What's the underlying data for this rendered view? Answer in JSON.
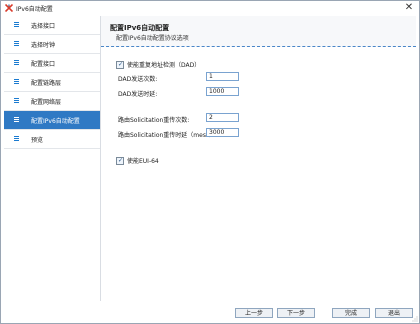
{
  "window": {
    "title": "IPv6自动配置",
    "close_glyph": "✕"
  },
  "sidebar": {
    "items": [
      {
        "label": "选择接口",
        "active": false
      },
      {
        "label": "选择时钟",
        "active": false
      },
      {
        "label": "配置接口",
        "active": false
      },
      {
        "label": "配置链路层",
        "active": false
      },
      {
        "label": "配置网络层",
        "active": false
      },
      {
        "label": "配置IPv6自动配置",
        "active": true
      },
      {
        "label": "预览",
        "active": false
      }
    ]
  },
  "header": {
    "title": "配置IPv6自动配置",
    "subtitle": "配置IPv6自动配置协议选项"
  },
  "form": {
    "dad_checkbox_label": "使能重复地址检测（DAD）",
    "dad_checked": true,
    "dad_count_label": "DAD发送次数:",
    "dad_count_value": "1",
    "dad_delay_label": "DAD发送时延:",
    "dad_delay_value": "1000",
    "rs_count_label": "路由Solicitation重传次数:",
    "rs_count_value": "2",
    "rs_delay_label": "路由Solicitation重传时延（mesc）:",
    "rs_delay_value": "3000",
    "eui_checkbox_label": "使能EUI-64",
    "eui_checked": true
  },
  "footer": {
    "prev": "上一步",
    "next": "下一步",
    "finish": "完成",
    "exit": "退出"
  },
  "colors": {
    "accent": "#2f79c4",
    "icon_blue": "#1a7bd1",
    "brand_red": "#d93a2b"
  },
  "icons": {
    "app": "app-logo-icon",
    "menu": "menu-lines-icon",
    "check": "checkmark-icon"
  }
}
